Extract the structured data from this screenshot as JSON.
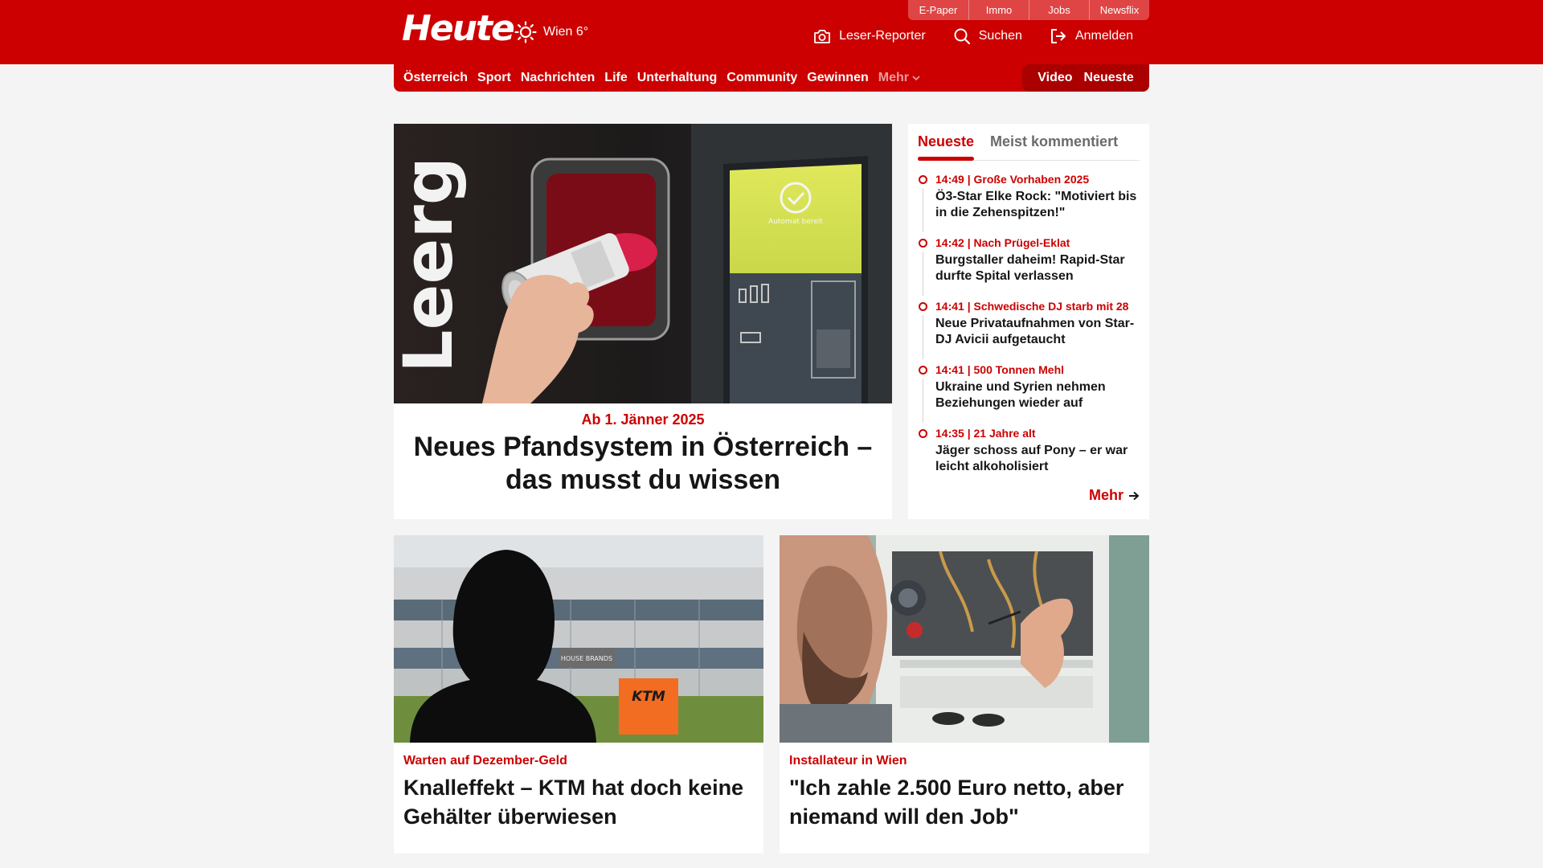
{
  "brand": {
    "logo": "Heute",
    "accent": "#cc0000"
  },
  "weather": {
    "icon": "sun-icon",
    "text": "Wien 6°"
  },
  "utility_links": [
    "E-Paper",
    "Immo",
    "Jobs",
    "Newsflix"
  ],
  "header_actions": {
    "reporter": {
      "icon": "camera-icon",
      "label": "Leser-Reporter"
    },
    "search": {
      "icon": "search-icon",
      "label": "Suchen"
    },
    "login": {
      "icon": "login-icon",
      "label": "Anmelden"
    }
  },
  "nav": {
    "items": [
      "Österreich",
      "Sport",
      "Nachrichten",
      "Life",
      "Unterhaltung",
      "Community",
      "Gewinnen"
    ],
    "more": "Mehr",
    "right": [
      "Video",
      "Neueste"
    ]
  },
  "hero": {
    "kicker": "Ab 1. Jänner 2025",
    "title": "Neues Pfandsystem in Österreich – das musst du wissen",
    "image_text": "Leerg",
    "screen_text": "Automat bereit"
  },
  "sidebar": {
    "tabs": [
      "Neueste",
      "Meist kommentiert"
    ],
    "items": [
      {
        "meta": "14:49 | Große Vorhaben 2025",
        "title": "Ö3-Star Elke Rock: \"Motiviert bis in die Zehenspitzen!\""
      },
      {
        "meta": "14:42 | Nach Prügel-Eklat",
        "title": "Burgstaller daheim! Rapid-Star durfte Spital verlassen"
      },
      {
        "meta": "14:41 | Schwedische DJ starb mit 28",
        "title": "Neue Privataufnahmen von Star-DJ Avicii aufgetaucht"
      },
      {
        "meta": "14:41 | 500 Tonnen Mehl",
        "title": "Ukraine und Syrien nehmen Beziehungen wieder auf"
      },
      {
        "meta": "14:35 | 21 Jahre alt",
        "title": "Jäger schoss auf Pony – er war leicht alkoholisiert"
      }
    ],
    "more": "Mehr"
  },
  "cards": [
    {
      "kicker": "Warten auf Dezember-Geld",
      "title": "Knalleffekt – KTM hat doch keine Gehälter überwiesen",
      "sign": "HOUSE BRANDS",
      "logo": "KTM"
    },
    {
      "kicker": "Installateur in Wien",
      "title": "\"Ich zahle 2.500 Euro netto, aber niemand will den Job\""
    }
  ]
}
